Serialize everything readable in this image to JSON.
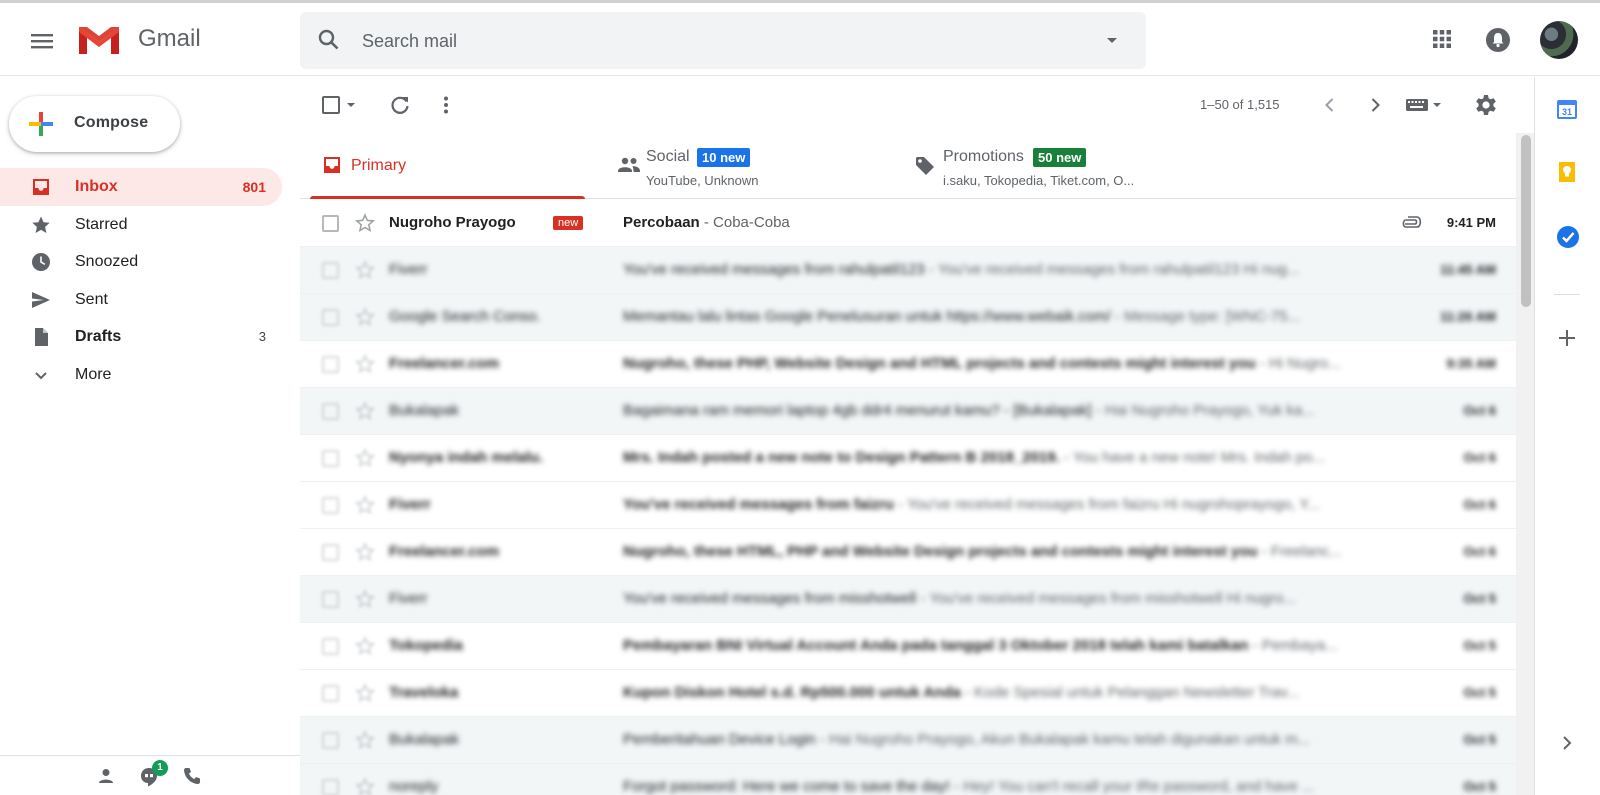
{
  "app": {
    "name": "Gmail"
  },
  "search": {
    "placeholder": "Search mail"
  },
  "sidebar": {
    "compose_label": "Compose",
    "items": [
      {
        "label": "Inbox",
        "count": "801",
        "icon": "inbox-icon"
      },
      {
        "label": "Starred",
        "count": "",
        "icon": "star-icon"
      },
      {
        "label": "Snoozed",
        "count": "",
        "icon": "clock-icon"
      },
      {
        "label": "Sent",
        "count": "",
        "icon": "send-icon"
      },
      {
        "label": "Drafts",
        "count": "3",
        "icon": "draft-icon"
      },
      {
        "label": "More",
        "count": "",
        "icon": "chevron-down-icon"
      }
    ],
    "hangouts_badge": "1"
  },
  "toolbar": {
    "pager": "1–50 of 1,515"
  },
  "tabs": [
    {
      "name": "Primary",
      "badge": "",
      "sub": ""
    },
    {
      "name": "Social",
      "badge": "10 new",
      "badge_color": "#1a73e8",
      "sub": "YouTube, Unknown"
    },
    {
      "name": "Promotions",
      "badge": "50 new",
      "badge_color": "#188038",
      "sub": "i.saku, Tokopedia, Tiket.com, O..."
    }
  ],
  "emails": [
    {
      "sender": "Nugroho Prayogo",
      "tag": "new",
      "subject": "Percobaan",
      "snippet": " - Coba-Coba",
      "time": "9:41 PM",
      "unread": true,
      "attachment": true,
      "blurred": false
    },
    {
      "sender": "Fiverr",
      "subject": "You've received messages from rahulpatil123",
      "snippet": " - You've received messages from rahulpatil123 Hi nug...",
      "time": "11:45 AM",
      "unread": false,
      "blurred": true
    },
    {
      "sender": "Google Search Conso.",
      "subject": "Memantau lalu lintas Google Penelusuran untuk https://www.webaik.com/",
      "snippet": " - Message type: [WNC-75...",
      "time": "11:26 AM",
      "unread": false,
      "blurred": true
    },
    {
      "sender": "Freelancer.com",
      "subject": "Nugroho, these PHP, Website Design and HTML projects and contests might interest you",
      "snippet": " - Hi Nugro...",
      "time": "9:35 AM",
      "unread": true,
      "blurred": true
    },
    {
      "sender": "Bukalapak",
      "subject": "Bagaimana ram memori laptop 4gb ddr4 menurut kamu? - [Bukalapak]",
      "snippet": " - Hai Nugroho Prayogo, Yuk ka...",
      "time": "Oct 6",
      "unread": false,
      "blurred": true
    },
    {
      "sender": "Nyonya indah melalu.",
      "subject": "Mrs. Indah posted a new note to Design Pattern B 2018_2019.",
      "snippet": " - You have a new note! Mrs. Indah po...",
      "time": "Oct 6",
      "unread": true,
      "blurred": true
    },
    {
      "sender": "Fiverr",
      "subject": "You've received messages from faizru",
      "snippet": " - You've received messages from faizru Hi nugrohoprayogo, Y...",
      "time": "Oct 6",
      "unread": true,
      "blurred": true
    },
    {
      "sender": "Freelancer.com",
      "subject": "Nugroho, these HTML, PHP and Website Design projects and contests might interest you",
      "snippet": " - Freelanc...",
      "time": "Oct 6",
      "unread": true,
      "blurred": true
    },
    {
      "sender": "Fiverr",
      "subject": "You've received messages from misshotwell",
      "snippet": " - You've received messages from misshotwell Hi nugro...",
      "time": "Oct 5",
      "unread": false,
      "blurred": true
    },
    {
      "sender": "Tokopedia",
      "subject": "Pembayaran BNI Virtual Account Anda pada tanggal 3 Oktober 2018 telah kami batalkan",
      "snippet": " - Pembaya...",
      "time": "Oct 5",
      "unread": true,
      "blurred": true
    },
    {
      "sender": "Traveloka",
      "subject": "Kupon Diskon Hotel s.d. Rp500.000 untuk Anda",
      "snippet": " - Kode Spesial untuk Pelanggan Newsletter Trav...",
      "time": "Oct 5",
      "unread": true,
      "blurred": true
    },
    {
      "sender": "Bukalapak",
      "subject": "Pemberitahuan Device Login",
      "snippet": " - Hai Nugroho Prayogo, Akun Bukalapak kamu telah digunakan untuk m...",
      "time": "Oct 5",
      "unread": false,
      "blurred": true
    },
    {
      "sender": "noreply",
      "subject": "Forgot password: Here we come to save the day!",
      "snippet": " - Hey! You can't recall your IRe password, and have ...",
      "time": "Oct 5",
      "unread": false,
      "blurred": true
    }
  ],
  "colors": {
    "accent": "#d93025",
    "nav_active_bg": "#fce8e6"
  }
}
